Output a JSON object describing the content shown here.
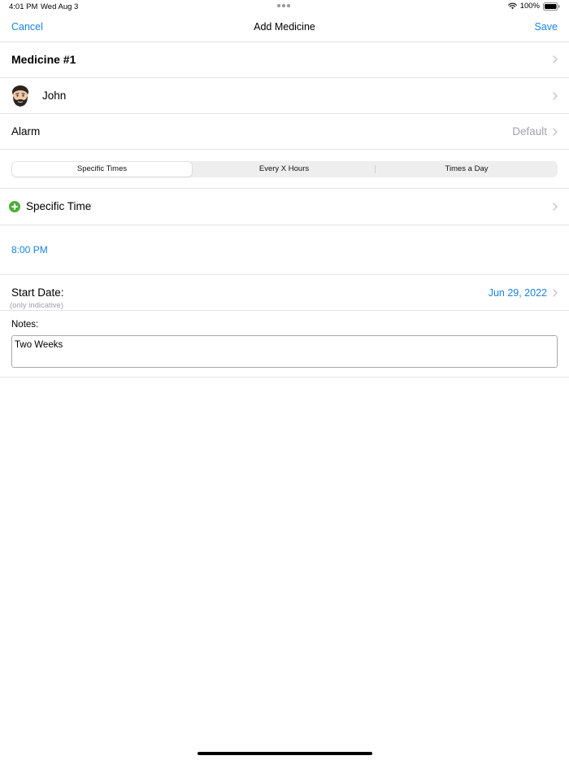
{
  "status_bar": {
    "time": "4:01 PM",
    "date": "Wed Aug 3",
    "battery": "100%"
  },
  "nav": {
    "cancel_label": "Cancel",
    "title": "Add Medicine",
    "save_label": "Save"
  },
  "medicine": {
    "name": "Medicine #1"
  },
  "person": {
    "name": "John",
    "avatar_icon": "bearded-man-emoji"
  },
  "alarm": {
    "label": "Alarm",
    "value": "Default"
  },
  "schedule_segments": {
    "options": [
      "Specific Times",
      "Every X Hours",
      "Times a Day"
    ],
    "selected": "Specific Times"
  },
  "specific_time": {
    "label": "Specific Time",
    "icon": "plus-circle-icon",
    "times": [
      "8:00 PM"
    ]
  },
  "start_date": {
    "label": "Start Date:",
    "sublabel": "(only indicative)",
    "value": "Jun 29, 2022"
  },
  "notes": {
    "label": "Notes:",
    "value": "Two Weeks"
  },
  "colors": {
    "accent": "#1a82e6",
    "secondary_text": "#a3a3a8",
    "plus_green": "#4caf3a",
    "separator": "#e3e3e6"
  }
}
